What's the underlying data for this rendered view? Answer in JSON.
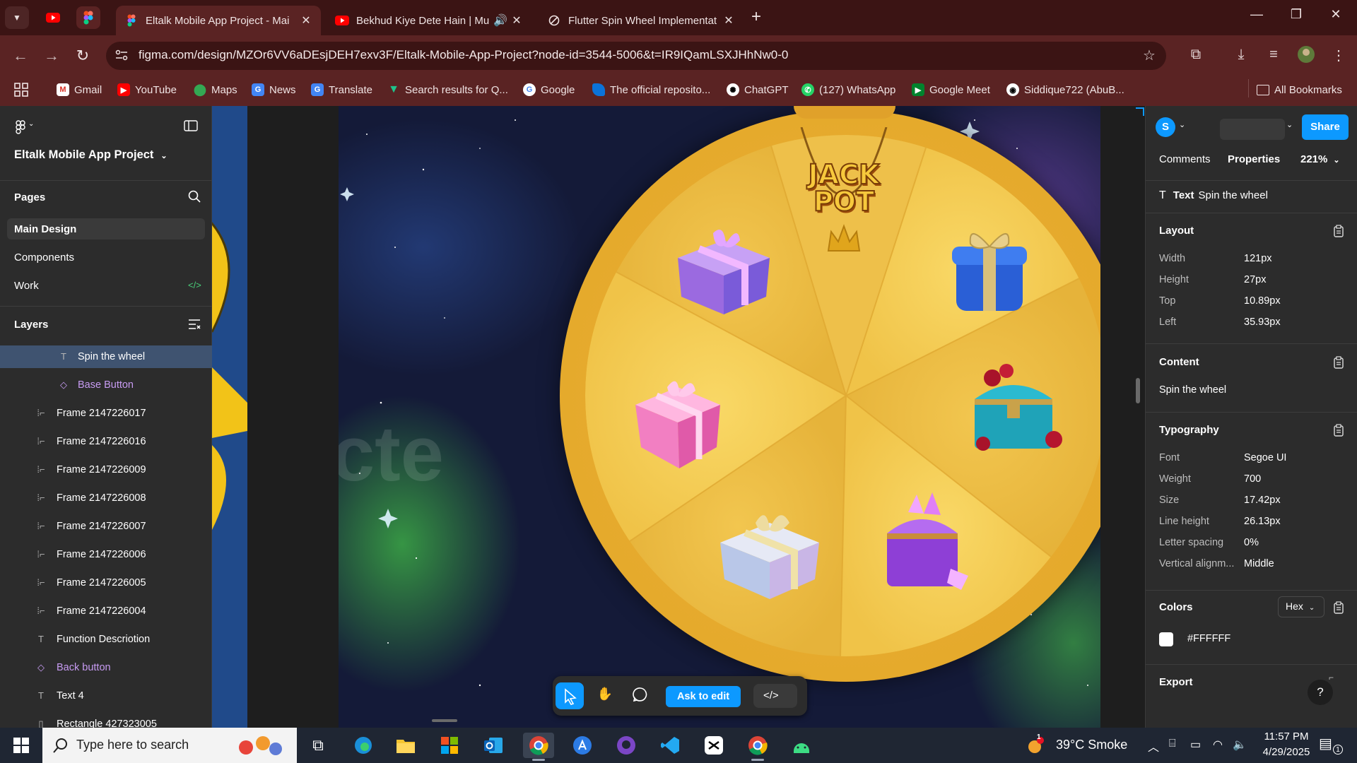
{
  "browser": {
    "tabs": [
      {
        "title": "Eltalk Mobile App Project - Mai",
        "active": true
      },
      {
        "title": "Bekhud Kiye Dete Hain | Mu",
        "active": false
      },
      {
        "title": "Flutter Spin Wheel Implementat",
        "active": false
      }
    ],
    "url": "figma.com/design/MZOr6VV6aDEsjDEH7exv3F/Eltalk-Mobile-App-Project?node-id=3544-5006&t=IR9IQamLSXJHhNw0-0",
    "bookmarks": [
      "Gmail",
      "YouTube",
      "Maps",
      "News",
      "Translate",
      "Search results for Q...",
      "Google",
      "The official reposito...",
      "ChatGPT",
      "(127) WhatsApp",
      "Google Meet",
      "Siddique722 (AbuB..."
    ],
    "all_bookmarks": "All Bookmarks"
  },
  "figma": {
    "project": "Eltalk Mobile App Project",
    "pages_title": "Pages",
    "pages": [
      "Main Design",
      "Components",
      "Work"
    ],
    "layers_title": "Layers",
    "layers": [
      {
        "name": "Spin the wheel",
        "type": "text",
        "selected": true
      },
      {
        "name": "Base Button",
        "type": "component"
      },
      {
        "name": "Frame 2147226017",
        "type": "frame"
      },
      {
        "name": "Frame 2147226016",
        "type": "frame"
      },
      {
        "name": "Frame 2147226009",
        "type": "frame"
      },
      {
        "name": "Frame 2147226008",
        "type": "frame"
      },
      {
        "name": "Frame 2147226007",
        "type": "frame"
      },
      {
        "name": "Frame 2147226006",
        "type": "frame"
      },
      {
        "name": "Frame 2147226005",
        "type": "frame"
      },
      {
        "name": "Frame 2147226004",
        "type": "frame"
      },
      {
        "name": "Function Descriotion",
        "type": "text"
      },
      {
        "name": "Back button",
        "type": "component"
      },
      {
        "name": "Text 4",
        "type": "text"
      },
      {
        "name": "Rectangle 427323005",
        "type": "rect"
      }
    ],
    "canvas": {
      "jackpot_text": [
        "JACK",
        "POT"
      ],
      "prizes": [
        "purple-gift",
        "blue-gift",
        "pink-gift",
        "treasure-chest",
        "pearl-gift",
        "crystal-chest"
      ]
    },
    "floating_toolbar": {
      "ask_to_edit": "Ask to edit"
    },
    "right_panel": {
      "avatar_letter": "S",
      "share": "Share",
      "tabs": [
        "Comments",
        "Properties"
      ],
      "zoom": "221%",
      "selection_kind": "Text",
      "selection_name": "Spin the wheel",
      "layout_title": "Layout",
      "layout": [
        {
          "label": "Width",
          "value": "121px"
        },
        {
          "label": "Height",
          "value": "27px"
        },
        {
          "label": "Top",
          "value": "10.89px"
        },
        {
          "label": "Left",
          "value": "35.93px"
        }
      ],
      "content_title": "Content",
      "content_value": "Spin the wheel",
      "typography_title": "Typography",
      "typography": [
        {
          "label": "Font",
          "value": "Segoe UI"
        },
        {
          "label": "Weight",
          "value": "700"
        },
        {
          "label": "Size",
          "value": "17.42px"
        },
        {
          "label": "Line height",
          "value": "26.13px"
        },
        {
          "label": "Letter spacing",
          "value": "0%"
        },
        {
          "label": "Vertical alignm...",
          "value": "Middle"
        }
      ],
      "colors_title": "Colors",
      "color_format": "Hex",
      "color_value": "#FFFFFF",
      "export_title": "Export"
    }
  },
  "taskbar": {
    "search_placeholder": "Type here to search",
    "weather": "39°C Smoke",
    "time": "11:57 PM",
    "date": "4/29/2025",
    "notification_count": "1"
  },
  "colors": {
    "figma_blue": "#0d99ff",
    "browser_red": "#5a2323",
    "wheel_gold": "#e3a526"
  }
}
